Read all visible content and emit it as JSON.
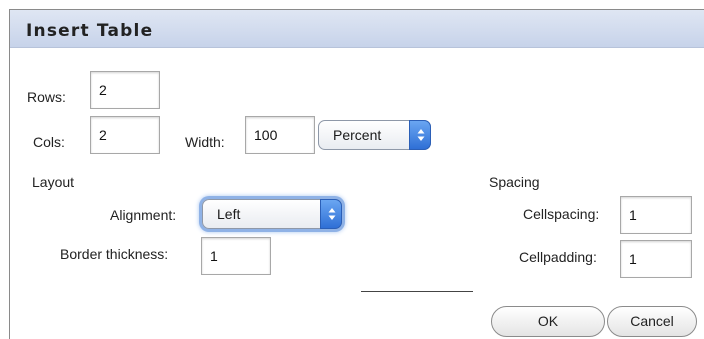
{
  "dialog": {
    "title": "Insert Table"
  },
  "table_size": {
    "rows_label": "Rows:",
    "rows_value": "2",
    "cols_label": "Cols:",
    "cols_value": "2",
    "width_label": "Width:",
    "width_value": "100",
    "width_unit": "Percent"
  },
  "layout": {
    "heading": "Layout",
    "alignment_label": "Alignment:",
    "alignment_value": "Left",
    "border_label": "Border thickness:",
    "border_value": "1"
  },
  "spacing": {
    "heading": "Spacing",
    "cellspacing_label": "Cellspacing:",
    "cellspacing_value": "1",
    "cellpadding_label": "Cellpadding:",
    "cellpadding_value": "1"
  },
  "buttons": {
    "ok_label": "OK",
    "cancel_label": "Cancel"
  },
  "icons": {
    "select_stepper": "updown-arrows-icon"
  },
  "colors": {
    "accent": "#3b7be0",
    "titlebar": "#d3dcee"
  }
}
